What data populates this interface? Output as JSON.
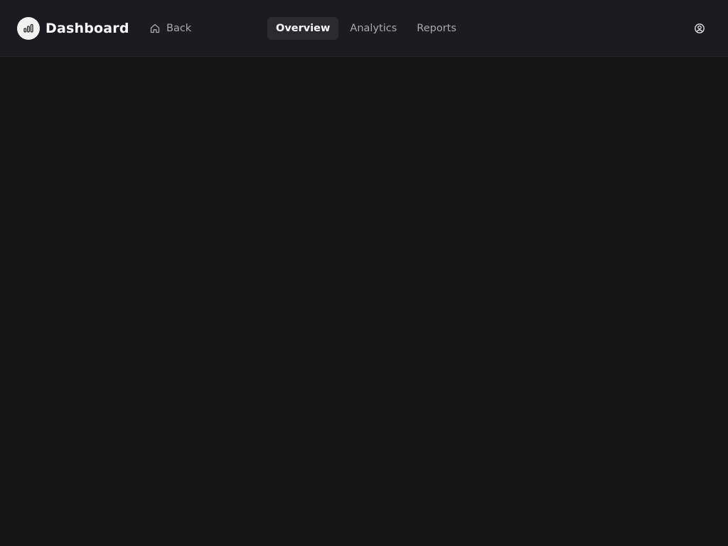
{
  "header": {
    "title": "Dashboard",
    "logo_icon": "bar-chart-icon",
    "back_label": "Back",
    "back_icon": "home-icon",
    "user_icon": "user-circle-icon"
  },
  "tabs": [
    {
      "label": "Overview",
      "active": true
    },
    {
      "label": "Analytics",
      "active": false
    },
    {
      "label": "Reports",
      "active": false
    }
  ],
  "colors": {
    "header_bg": "#1c1c20",
    "page_bg": "#141414",
    "active_tab_bg": "#2b2b2f",
    "text_primary": "#ffffff",
    "text_muted": "#a8a8ae"
  }
}
